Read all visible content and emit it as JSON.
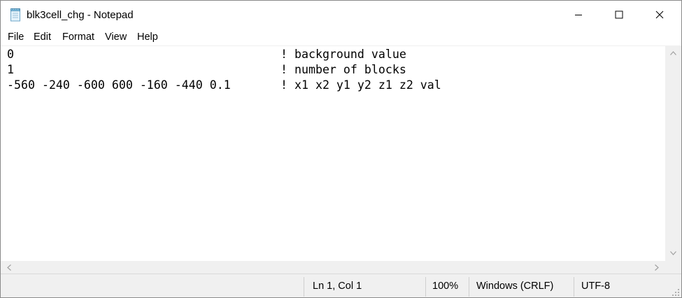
{
  "window": {
    "title": "blk3cell_chg - Notepad",
    "app_icon": "notepad-icon",
    "controls": [
      "minimize-icon",
      "maximize-icon",
      "close-icon"
    ]
  },
  "menu": {
    "file": "File",
    "edit": "Edit",
    "format": "Format",
    "view": "View",
    "help": "Help"
  },
  "editor": {
    "lines": [
      {
        "value": "0",
        "comment": "! background value"
      },
      {
        "value": "1",
        "comment": "! number of blocks"
      },
      {
        "value": "-560 -240 -600 600 -160 -440 0.1",
        "comment": "! x1 x2 y1 y2 z1 z2 val"
      }
    ]
  },
  "statusbar": {
    "position": "Ln 1, Col 1",
    "zoom": "100%",
    "line_ending": "Windows (CRLF)",
    "encoding": "UTF-8"
  },
  "colors": {
    "chrome_background": "#f0f0f0",
    "text": "#000000",
    "scroll_arrow": "#a0a0a0"
  }
}
